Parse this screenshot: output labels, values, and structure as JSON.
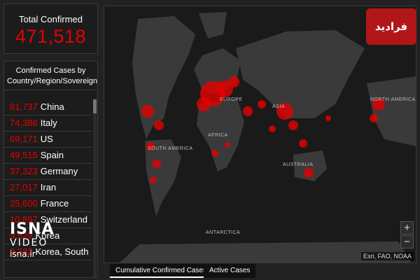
{
  "total": {
    "label": "Total Confirmed",
    "value": "471,518"
  },
  "list": {
    "header": "Confirmed Cases by Country/Region/Sovereignty",
    "rows": [
      {
        "value": "81,737",
        "country": "China"
      },
      {
        "value": "74,386",
        "country": "Italy"
      },
      {
        "value": "69,171",
        "country": "US"
      },
      {
        "value": "49,515",
        "country": "Spain"
      },
      {
        "value": "37,323",
        "country": "Germany"
      },
      {
        "value": "27,017",
        "country": "Iran"
      },
      {
        "value": "25,600",
        "country": "France"
      },
      {
        "value": "10,897",
        "country": "Switzerland"
      },
      {
        "value": "9,529",
        "country": "Korea"
      },
      {
        "value": "9,332",
        "country": "Korea, South"
      }
    ]
  },
  "map": {
    "labels": {
      "europe": "EUROPE",
      "asia": "ASIA",
      "africa": "AFRICA",
      "south_america": "SOUTH AMERICA",
      "australia": "AUSTRALIA",
      "antarctica": "ANTARCTICA",
      "north_america": "NORTH AMERICA"
    },
    "attribution": "Esri, FAO, NOAA",
    "zoom_in": "+",
    "zoom_out": "−"
  },
  "tabs": {
    "cumulative": "Cumulative Confirmed Cases",
    "active": "Active Cases"
  },
  "overlay": {
    "logo_text": "فرادید",
    "watermark": {
      "line1": "ISNA",
      "line2": "VIDEO",
      "line3": "isna.ir"
    }
  },
  "colors": {
    "accent": "#e60000",
    "background": "#222222",
    "land": "#3a3a3a"
  }
}
